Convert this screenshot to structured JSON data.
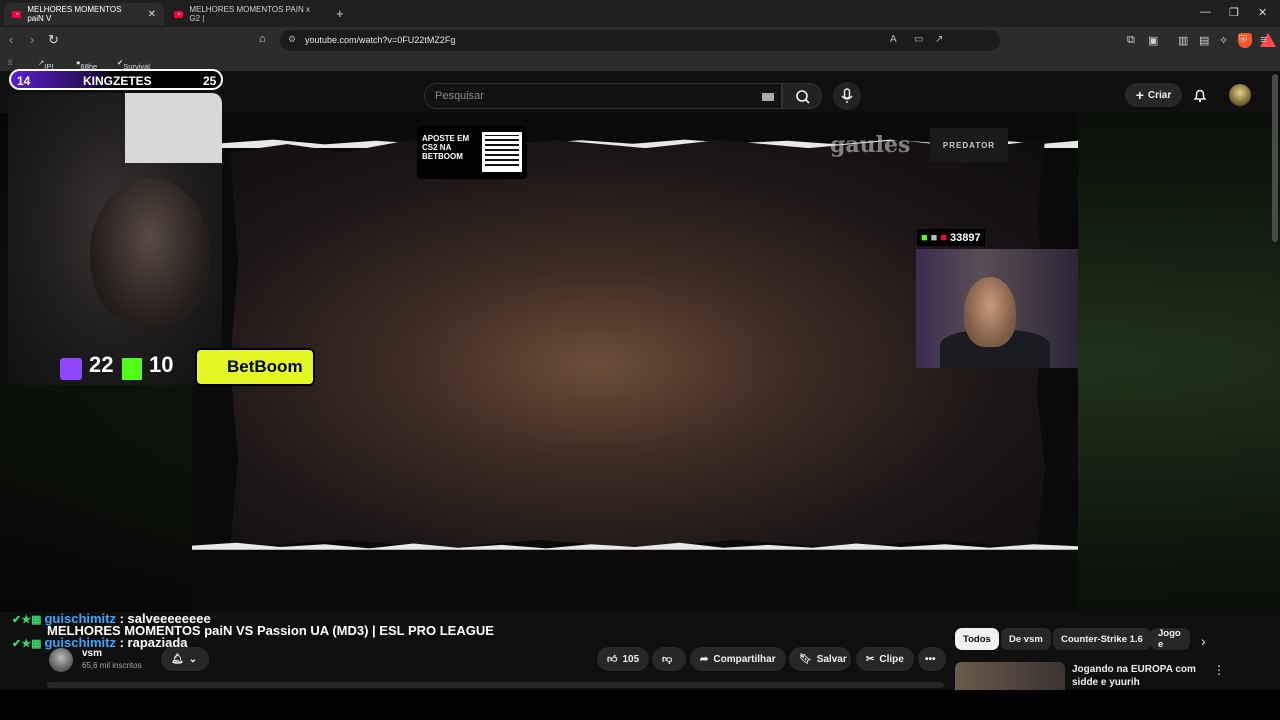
{
  "browser": {
    "tabs": [
      {
        "label": "MELHORES MOMENTOS paiN V"
      },
      {
        "label": "MELHORES MOMENTOS PAIN x G2 |"
      }
    ],
    "url": "youtube.com/watch?v=0FU22tMZ2Fg",
    "bookmarks": [
      "IPI",
      "68he",
      "Survival Knife"
    ],
    "brave_badge": "1"
  },
  "header": {
    "search_placeholder": "Pesquisar",
    "create_label": "Criar"
  },
  "overlay": {
    "scoreboard": {
      "left_score": "14",
      "team": "KINGZETES",
      "right_score": "25"
    },
    "twitch_viewers": "22",
    "kick_viewers": "10",
    "sponsor": "BetBoom",
    "promo_text": "APOSTE EM CS2 NA BETBOOM",
    "watermark": "gaules",
    "predator": "PREDATOR",
    "pip_viewers": "33897"
  },
  "chat": [
    {
      "user": "guischimitz",
      "message": " : salveeeeeeee"
    },
    {
      "user": "guischimitz",
      "message": " : rapaziada"
    }
  ],
  "video": {
    "title": "MELHORES MOMENTOS paiN VS Passion UA (MD3) | ESL PRO LEAGUE",
    "channel": "vsm",
    "subscribers": "65,6 mil inscritos",
    "likes": "105",
    "share_label": "Compartilhar",
    "save_label": "Salvar",
    "clip_label": "Clipe"
  },
  "related": {
    "chips": [
      "Todos",
      "De vsm",
      "Counter-Strike 1.6",
      "Jogo e"
    ],
    "first_title": "Jogando na EUROPA com sidde e yuurih"
  }
}
